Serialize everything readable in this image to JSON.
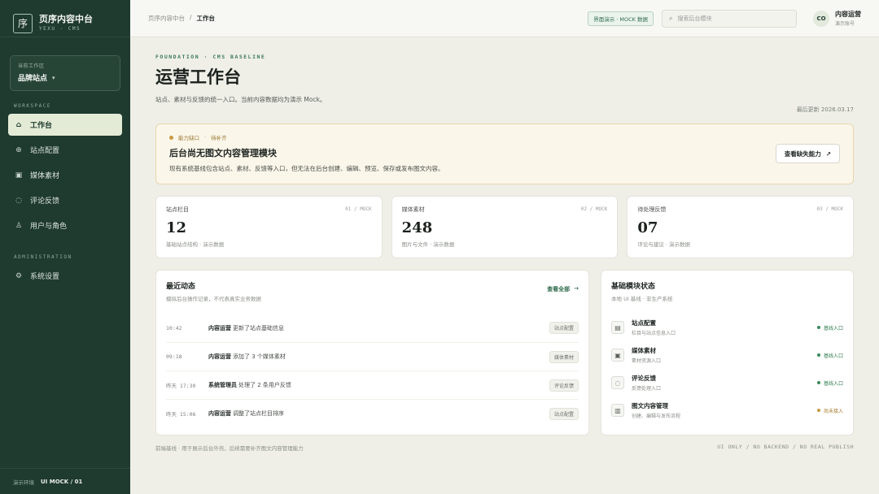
{
  "brand": {
    "logo": "序",
    "title": "页序内容中台",
    "subtitle": "YEXU · CMS"
  },
  "workspace": {
    "label": "当前工作区",
    "value": "品牌站点"
  },
  "sidebar": {
    "section_workspace": "WORKSPACE",
    "items": [
      {
        "label": "工作台",
        "icon": "home-icon",
        "glyph": "⌂",
        "active": true
      },
      {
        "label": "站点配置",
        "icon": "globe-icon",
        "glyph": "⊕",
        "active": false
      },
      {
        "label": "媒体素材",
        "icon": "image-icon",
        "glyph": "▣",
        "active": false
      },
      {
        "label": "评论反馈",
        "icon": "comment-icon",
        "glyph": "◌",
        "active": false
      },
      {
        "label": "用户与角色",
        "icon": "users-icon",
        "glyph": "♙",
        "active": false
      }
    ],
    "section_admin": "ADMINISTRATION",
    "admin_items": [
      {
        "label": "系统设置",
        "icon": "gear-icon",
        "glyph": "⚙"
      }
    ],
    "env_label": "演示环境",
    "env_value": "UI MOCK / 01"
  },
  "topbar": {
    "breadcrumb_root": "页序内容中台",
    "breadcrumb_sep": "/",
    "breadcrumb_current": "工作台",
    "mock_badge": "界面演示 · MOCK 数据",
    "search_placeholder": "搜索后台模块",
    "user": {
      "initials": "CO",
      "name": "内容运营",
      "role": "演示账号"
    }
  },
  "page": {
    "eyebrow": "FOUNDATION · CMS BASELINE",
    "title": "运营工作台",
    "description": "站点、素材与反馈的统一入口。当前内容数据均为演示 Mock。",
    "updated": "最后更新 2026.03.17"
  },
  "alert": {
    "tag1": "能力缺口",
    "tag2": "待补齐",
    "title": "后台尚无图文内容管理模块",
    "description": "现有系统基线包含站点、素材、反馈等入口，但无法在后台创建、编辑、预览、保存或发布图文内容。",
    "button": "查看缺失能力",
    "button_icon": "↗"
  },
  "stats": [
    {
      "label": "站点栏目",
      "code": "01 / MOCK",
      "value": "12",
      "note": "基础站点结构 · 演示数据"
    },
    {
      "label": "媒体素材",
      "code": "02 / MOCK",
      "value": "248",
      "note": "图片与文件 · 演示数据"
    },
    {
      "label": "待处理反馈",
      "code": "03 / MOCK",
      "value": "07",
      "note": "评论与建议 · 演示数据"
    }
  ],
  "activity": {
    "title": "最近动态",
    "subtitle": "模拟后台操作记录，不代表真实业务数据",
    "view_all": "查看全部",
    "view_all_icon": "→",
    "rows": [
      {
        "time": "10:42",
        "actor": "内容运营",
        "text": "更新了站点基础信息",
        "tag": "站点配置"
      },
      {
        "time": "09:18",
        "actor": "内容运营",
        "text": "添加了 3 个媒体素材",
        "tag": "媒体素材"
      },
      {
        "time": "昨天 17:30",
        "actor": "系统管理员",
        "text": "处理了 2 条用户反馈",
        "tag": "评论反馈"
      },
      {
        "time": "昨天 15:06",
        "actor": "内容运营",
        "text": "调整了站点栏目排序",
        "tag": "站点配置"
      }
    ]
  },
  "modules": {
    "title": "基础模块状态",
    "subtitle": "本地 UI 基线 · 非生产系统",
    "rows": [
      {
        "name": "站点配置",
        "desc": "栏目与站点信息入口",
        "status": "基线入口",
        "state": "ok",
        "icon": "layout-icon",
        "glyph": "▤"
      },
      {
        "name": "媒体素材",
        "desc": "素材资源入口",
        "status": "基线入口",
        "state": "ok",
        "icon": "image-icon",
        "glyph": "▣"
      },
      {
        "name": "评论反馈",
        "desc": "反馈处理入口",
        "status": "基线入口",
        "state": "ok",
        "icon": "comment-icon",
        "glyph": "◌"
      },
      {
        "name": "图文内容管理",
        "desc": "创建、编辑与发布流程",
        "status": "尚未接入",
        "state": "pending",
        "icon": "document-icon",
        "glyph": "▥"
      }
    ]
  },
  "footer": {
    "left": "前端基线 · 用于展示后台外壳，后续需要补齐图文内容管理能力",
    "right": "UI ONLY / NO BACKEND / NO REAL PUBLISH"
  }
}
